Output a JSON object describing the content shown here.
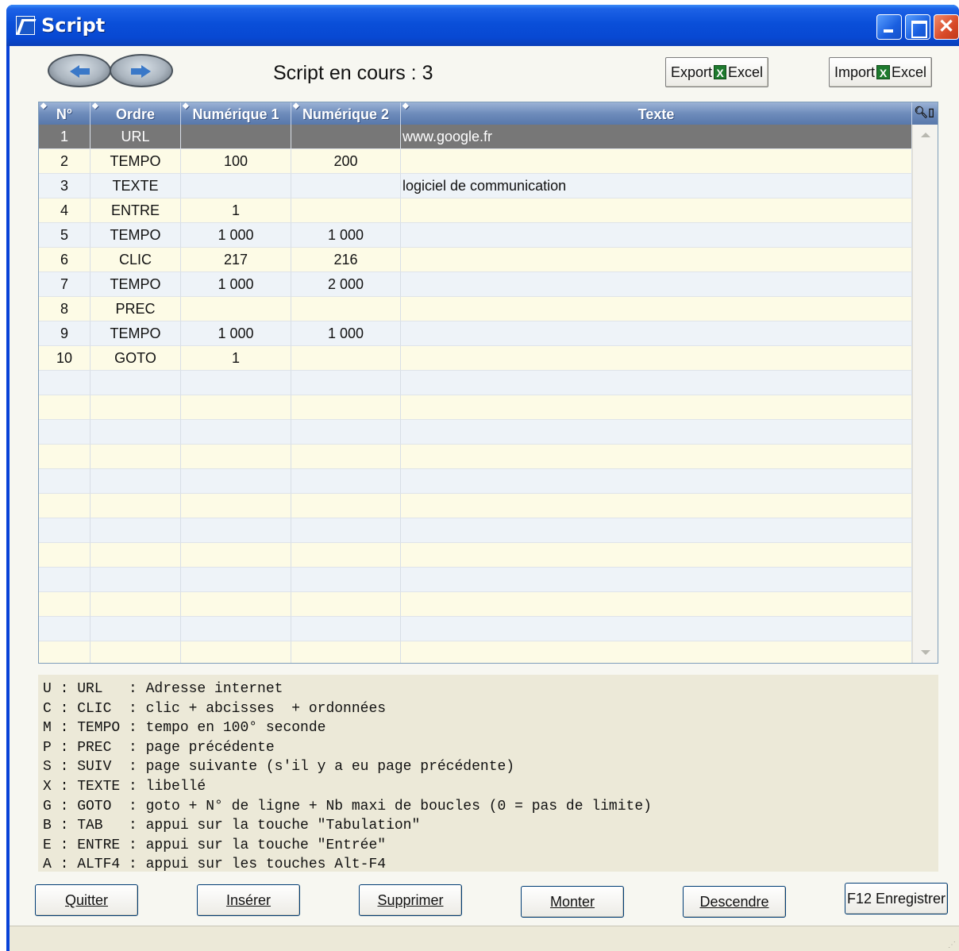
{
  "window": {
    "title": "Script"
  },
  "header": {
    "script_label": "Script en cours : 3",
    "export": {
      "prefix": "Export",
      "suffix": "Excel"
    },
    "import": {
      "prefix": "Import",
      "suffix": "Excel"
    }
  },
  "grid": {
    "columns": [
      "N°",
      "Ordre",
      "Numérique 1",
      "Numérique 2",
      "Texte"
    ],
    "rows": [
      {
        "num": "1",
        "ordre": "URL",
        "n1": "",
        "n2": "",
        "texte": "www.google.fr",
        "selected": true
      },
      {
        "num": "2",
        "ordre": "TEMPO",
        "n1": "100",
        "n2": "200",
        "texte": ""
      },
      {
        "num": "3",
        "ordre": "TEXTE",
        "n1": "",
        "n2": "",
        "texte": "logiciel de communication"
      },
      {
        "num": "4",
        "ordre": "ENTRE",
        "n1": "1",
        "n2": "",
        "texte": ""
      },
      {
        "num": "5",
        "ordre": "TEMPO",
        "n1": "1 000",
        "n2": "1 000",
        "texte": ""
      },
      {
        "num": "6",
        "ordre": "CLIC",
        "n1": "217",
        "n2": "216",
        "texte": ""
      },
      {
        "num": "7",
        "ordre": "TEMPO",
        "n1": "1 000",
        "n2": "2 000",
        "texte": ""
      },
      {
        "num": "8",
        "ordre": "PREC",
        "n1": "",
        "n2": "",
        "texte": ""
      },
      {
        "num": "9",
        "ordre": "TEMPO",
        "n1": "1 000",
        "n2": "1 000",
        "texte": ""
      },
      {
        "num": "10",
        "ordre": "GOTO",
        "n1": "1",
        "n2": "",
        "texte": ""
      }
    ]
  },
  "legend": [
    "U : URL   : Adresse internet",
    "C : CLIC  : clic + abcisses  + ordonnées",
    "M : TEMPO : tempo en 100° seconde",
    "P : PREC  : page précédente",
    "S : SUIV  : page suivante (s'il y a eu page précédente)",
    "X : TEXTE : libellé",
    "G : GOTO  : goto + N° de ligne + Nb maxi de boucles (0 = pas de limite)",
    "B : TAB   : appui sur la touche \"Tabulation\"",
    "E : ENTRE : appui sur la touche \"Entrée\"",
    "A : ALTF4 : appui sur les touches Alt-F4"
  ],
  "buttons": {
    "quitter": "Quitter",
    "inserer": "Insérer",
    "supprimer": "Supprimer",
    "monter": "Monter",
    "descendre": "Descendre",
    "enregistrer": "F12 Enregistrer"
  }
}
